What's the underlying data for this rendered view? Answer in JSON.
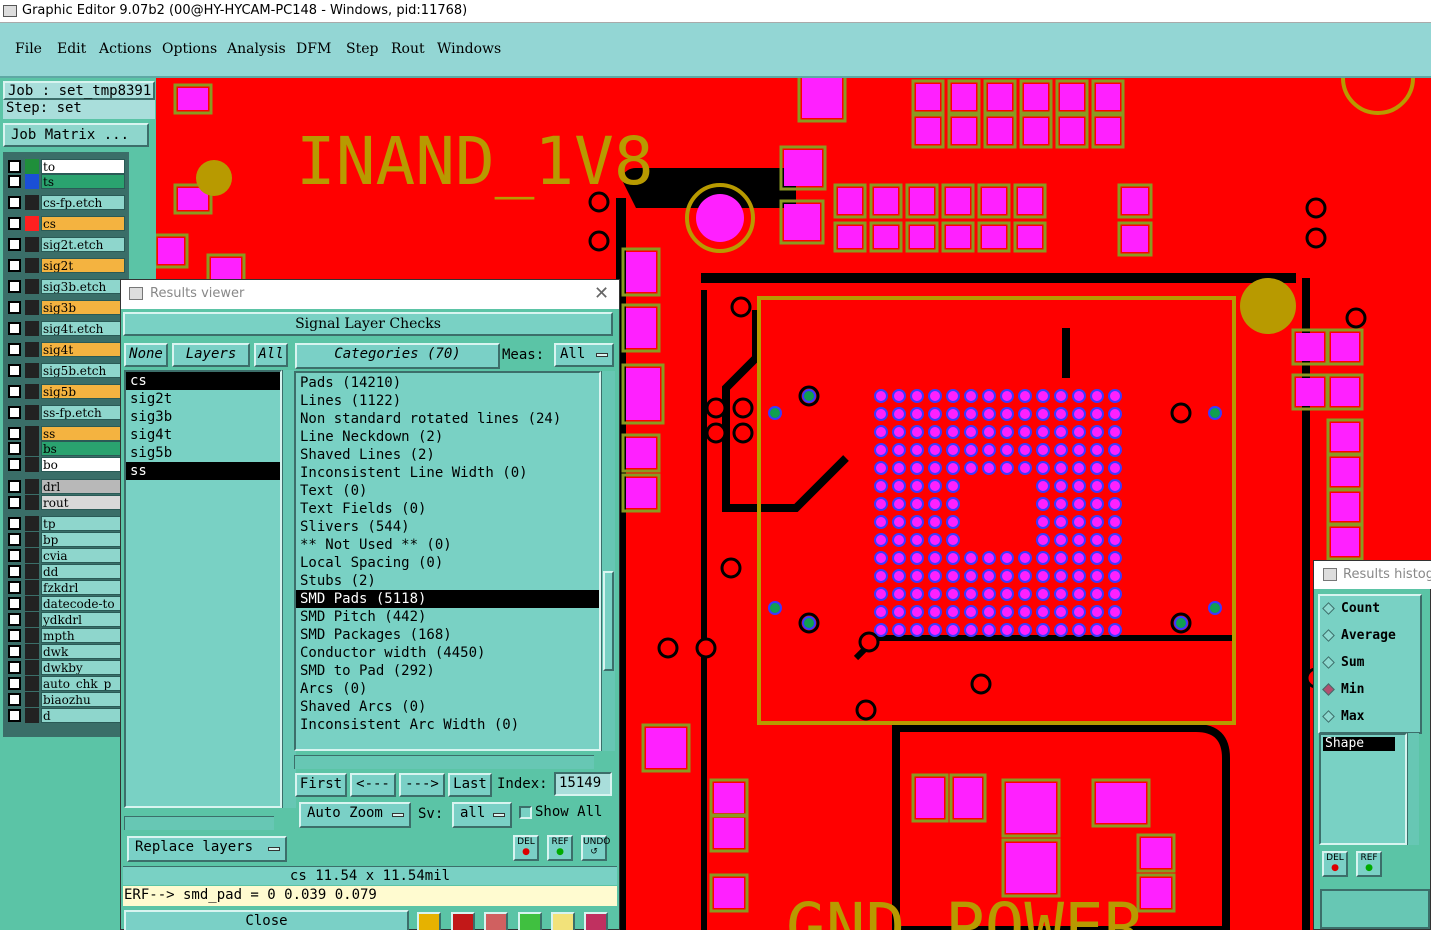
{
  "window": {
    "title": "Graphic Editor 9.07b2 (00@HY-HYCAM-PC148 - Windows, pid:11768)"
  },
  "menu": [
    "File",
    "Edit",
    "Actions",
    "Options",
    "Analysis",
    "DFM",
    "Step",
    "Rout",
    "Windows"
  ],
  "job": {
    "job_line": "Job : set_tmp8391",
    "step_line": "Step: set",
    "matrix_button": "Job Matrix ..."
  },
  "layers": [
    {
      "name": "to",
      "color": "#ffffff",
      "swatch": "#1f8f3a"
    },
    {
      "name": "ts",
      "color": "#2aa36f",
      "swatch": "#1a4fd6"
    },
    {
      "name": "cs-fp.etch",
      "color": "#8ed6cc",
      "swatch": "#222222"
    },
    {
      "name": "cs",
      "color": "#f4b340",
      "swatch": "#ff2020"
    },
    {
      "name": "sig2t.etch",
      "color": "#8ed6cc",
      "swatch": "#222222"
    },
    {
      "name": "sig2t",
      "color": "#f4b340",
      "swatch": "#222222"
    },
    {
      "name": "sig3b.etch",
      "color": "#8ed6cc",
      "swatch": "#222222"
    },
    {
      "name": "sig3b",
      "color": "#f4b340",
      "swatch": "#222222"
    },
    {
      "name": "sig4t.etch",
      "color": "#8ed6cc",
      "swatch": "#222222"
    },
    {
      "name": "sig4t",
      "color": "#f4b340",
      "swatch": "#222222"
    },
    {
      "name": "sig5b.etch",
      "color": "#8ed6cc",
      "swatch": "#222222"
    },
    {
      "name": "sig5b",
      "color": "#f4b340",
      "swatch": "#222222"
    },
    {
      "name": "ss-fp.etch",
      "color": "#8ed6cc",
      "swatch": "#222222"
    },
    {
      "name": "ss",
      "color": "#f4b340",
      "swatch": "#222222"
    },
    {
      "name": "bs",
      "color": "#2aa36f",
      "swatch": "#222222"
    },
    {
      "name": "bo",
      "color": "#ffffff",
      "swatch": "#222222"
    },
    {
      "name": "drl",
      "color": "#b8b8b8",
      "swatch": "#222222"
    },
    {
      "name": "rout",
      "color": "#d8d8d8",
      "swatch": "#222222"
    },
    {
      "name": "tp",
      "color": "#8ed6cc",
      "swatch": "#222222"
    },
    {
      "name": "bp",
      "color": "#8ed6cc",
      "swatch": "#222222"
    },
    {
      "name": "cvia",
      "color": "#8ed6cc",
      "swatch": "#222222"
    },
    {
      "name": "dd",
      "color": "#8ed6cc",
      "swatch": "#222222"
    },
    {
      "name": "fzkdrl",
      "color": "#8ed6cc",
      "swatch": "#222222"
    },
    {
      "name": "datecode-to",
      "color": "#8ed6cc",
      "swatch": "#222222"
    },
    {
      "name": "ydkdrl",
      "color": "#8ed6cc",
      "swatch": "#222222"
    },
    {
      "name": "mpth",
      "color": "#8ed6cc",
      "swatch": "#222222"
    },
    {
      "name": "dwk",
      "color": "#8ed6cc",
      "swatch": "#222222"
    },
    {
      "name": "dwkby",
      "color": "#8ed6cc",
      "swatch": "#222222"
    },
    {
      "name": "auto_chk_p",
      "color": "#8ed6cc",
      "swatch": "#222222"
    },
    {
      "name": "biaozhu",
      "color": "#8ed6cc",
      "swatch": "#222222"
    },
    {
      "name": "d",
      "color": "#8ed6cc",
      "swatch": "#222222"
    }
  ],
  "canvas": {
    "label_top": "INAND_1V8",
    "label_bottom": "GND_POWER"
  },
  "results": {
    "title": "Results viewer",
    "header": "Signal Layer Checks",
    "none_btn": "None",
    "layers_btn": "Layers",
    "all_btn": "All",
    "categories_btn": "Categories (70)",
    "meas_label": "Meas:",
    "meas_value": "All",
    "layer_items": [
      "cs",
      "sig2t",
      "sig3b",
      "sig4t",
      "sig5b",
      "ss"
    ],
    "categories": [
      "Pads (14210)",
      "Lines (1122)",
      "Non standard rotated lines (24)",
      "Line Neckdown (2)",
      "Shaved Lines (2)",
      "Inconsistent Line Width (0)",
      "Text (0)",
      "Text Fields (0)",
      "Slivers (544)",
      "** Not Used ** (0)",
      "Local Spacing (0)",
      "Stubs (2)",
      "SMD Pads (5118)",
      "SMD Pitch (442)",
      "SMD Packages (168)",
      "Conductor width (4450)",
      "SMD to Pad (292)",
      "Arcs (0)",
      "Shaved Arcs (0)",
      "Inconsistent Arc Width (0)"
    ],
    "nav": {
      "first": "First",
      "prev": "<---",
      "next": "--->",
      "last": "Last",
      "index_label": "Index:",
      "index_value": "15149"
    },
    "auto_zoom": "Auto Zoom",
    "sv_label": "Sv:",
    "sv_value": "all",
    "show_all": "Show All",
    "replace_layers": "Replace layers",
    "del": "DEL",
    "ref": "REF",
    "undo": "UNDO",
    "status1": "cs 11.54 x 11.54mil",
    "status2": "ERF--> smd_pad = 0 0.039 0.079",
    "close": "Close"
  },
  "histogram": {
    "title": "Results histogram",
    "options": [
      "Count",
      "Average",
      "Sum",
      "Min",
      "Max"
    ],
    "selected": "Min",
    "list_item": "Shape",
    "del": "DEL",
    "ref": "REF"
  }
}
